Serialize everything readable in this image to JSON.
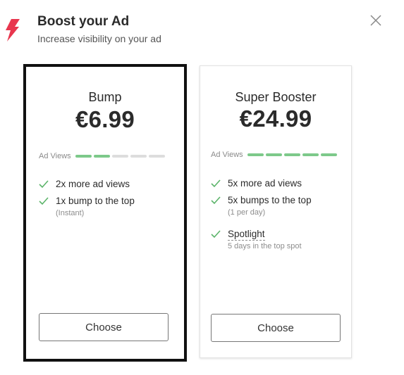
{
  "header": {
    "title": "Boost your Ad",
    "subtitle": "Increase visibility on your ad",
    "accent_color": "#e8364e",
    "icon": "lightning-bolt-icon",
    "close_icon": "close-icon"
  },
  "views_label": "Ad Views",
  "plans": [
    {
      "name": "Bump",
      "price": "€6.99",
      "ad_views_level": 2,
      "ad_views_max": 5,
      "features": [
        {
          "text": "2x more ad views"
        },
        {
          "text": "1x bump to the top",
          "sub": "(Instant)"
        }
      ],
      "button_label": "Choose",
      "selected": true
    },
    {
      "name": "Super Booster",
      "price": "€24.99",
      "ad_views_level": 5,
      "ad_views_max": 5,
      "features": [
        {
          "text": "5x more ad views"
        },
        {
          "text": "5x bumps to the top",
          "sub": "(1 per day)"
        },
        {
          "text": "Spotlight",
          "sub": "5 days in the top spot"
        }
      ],
      "button_label": "Choose",
      "selected": false
    }
  ],
  "colors": {
    "check": "#5cb46a",
    "views_on": "#7dc98a",
    "views_off": "#dddddd",
    "selected_border": "#111111"
  }
}
